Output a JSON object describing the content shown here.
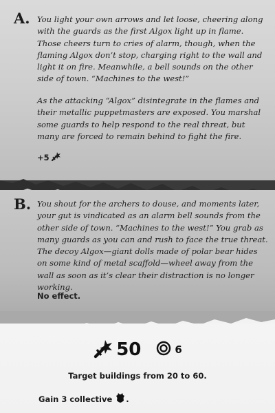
{
  "option_a": {
    "letter": "A.",
    "paragraph_1": "You light your own arrows and let loose, cheering along with the guards as the first Algox light up in flame. Those cheers turn to cries of alarm, though, when the flaming Algox don’t stop, charging right to the wall and light it on fire. Meanwhile, a bell sounds on the other side of town. “Machines to the west!”",
    "paragraph_2": "As the attacking “Algox” disintegrate in the flames and their metallic puppetmasters are exposed. You marshal some guards to help respond to the real threat, but many are forced to remain behind to fight the fire.",
    "effect_text": "+5",
    "effect_icon": "soldiers-icon"
  },
  "option_b": {
    "letter": "B.",
    "paragraph_1": "You shout for the archers to douse, and moments later, your gut is vindicated as an alarm bell sounds from the other side of town. “Machines to the west!” You grab as many guards as you can and rush to face the true threat. The decoy Algox—giant dolls made of polar bear hides on some kind of metal scaffold—wheel away from the wall as soon as it’s clear their distraction is no longer working.",
    "effect_text": "No effect."
  },
  "footer": {
    "soldiers_value": "50",
    "soldiers_icon": "soldiers-icon",
    "target_value": "6",
    "target_icon": "target-icon",
    "target_text": "Target buildings from 20 to 60.",
    "gain_text": "Gain 3 collective",
    "gain_icon": "hide-resource-icon",
    "gain_suffix": "."
  }
}
